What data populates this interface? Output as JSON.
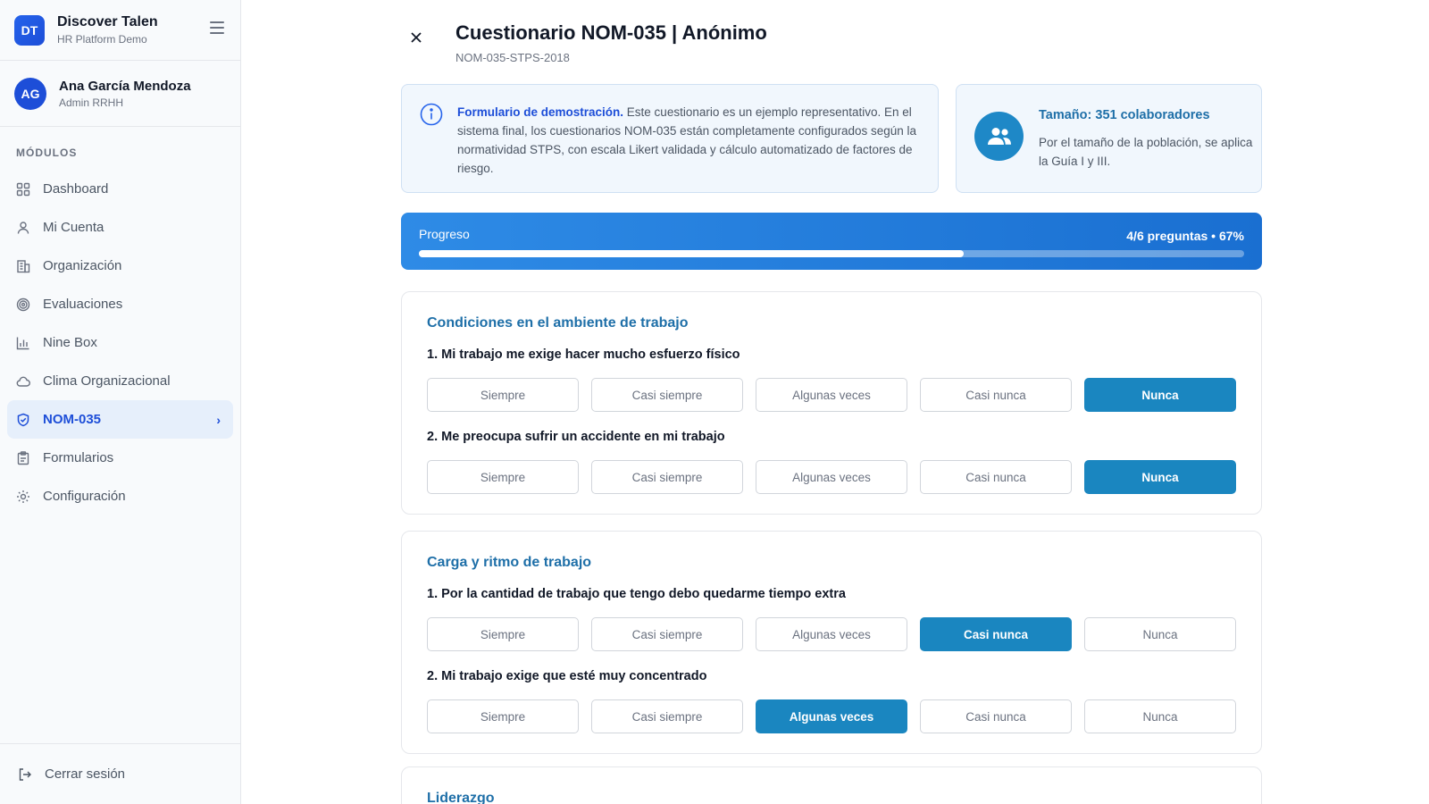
{
  "brand": {
    "logo": "DT",
    "title": "Discover Talen",
    "subtitle": "HR Platform Demo"
  },
  "user": {
    "initials": "AG",
    "name": "Ana García Mendoza",
    "role": "Admin RRHH"
  },
  "sidebar": {
    "section_label": "MÓDULOS",
    "items": [
      {
        "label": "Dashboard",
        "icon": "grid-icon"
      },
      {
        "label": "Mi Cuenta",
        "icon": "user-icon"
      },
      {
        "label": "Organización",
        "icon": "building-icon"
      },
      {
        "label": "Evaluaciones",
        "icon": "target-icon"
      },
      {
        "label": "Nine Box",
        "icon": "bar-chart-icon"
      },
      {
        "label": "Clima Organizacional",
        "icon": "cloud-icon"
      },
      {
        "label": "NOM-035",
        "icon": "shield-icon",
        "active": true
      },
      {
        "label": "Formularios",
        "icon": "clipboard-icon"
      },
      {
        "label": "Configuración",
        "icon": "gear-icon"
      }
    ],
    "logout_label": "Cerrar sesión"
  },
  "header": {
    "title": "Cuestionario NOM-035 | Anónimo",
    "code": "NOM-035-STPS-2018"
  },
  "info": {
    "bold": "Formulario de demostración.",
    "text": " Este cuestionario es un ejemplo representativo. En el sistema final, los cuestionarios NOM-035 están completamente configurados según la normatividad STPS, con escala Likert validada y cálculo automatizado de factores de riesgo."
  },
  "size_card": {
    "title": "Tamaño: 351 colaboradores",
    "text": "Por el tamaño de la población, se aplica la Guía I y III."
  },
  "progress": {
    "label": "Progreso",
    "meta": "4/6 preguntas • 67%",
    "value": 0.66
  },
  "options": [
    "Siempre",
    "Casi siempre",
    "Algunas veces",
    "Casi nunca",
    "Nunca"
  ],
  "sections": [
    {
      "title": "Condiciones en el ambiente de trabajo",
      "questions": [
        {
          "text": "1. Mi trabajo me exige hacer mucho esfuerzo físico",
          "selected": 4
        },
        {
          "text": "2. Me preocupa sufrir un accidente en mi trabajo",
          "selected": 4
        }
      ]
    },
    {
      "title": "Carga y ritmo de trabajo",
      "questions": [
        {
          "text": "1. Por la cantidad de trabajo que tengo debo quedarme tiempo extra",
          "selected": 3
        },
        {
          "text": "2. Mi trabajo exige que esté muy concentrado",
          "selected": 2
        }
      ]
    },
    {
      "title": "Liderazgo",
      "questions": []
    }
  ],
  "colors": {
    "accent": "#1d4ed8",
    "selected": "#1a86c0",
    "progress": "#2e8be6"
  }
}
